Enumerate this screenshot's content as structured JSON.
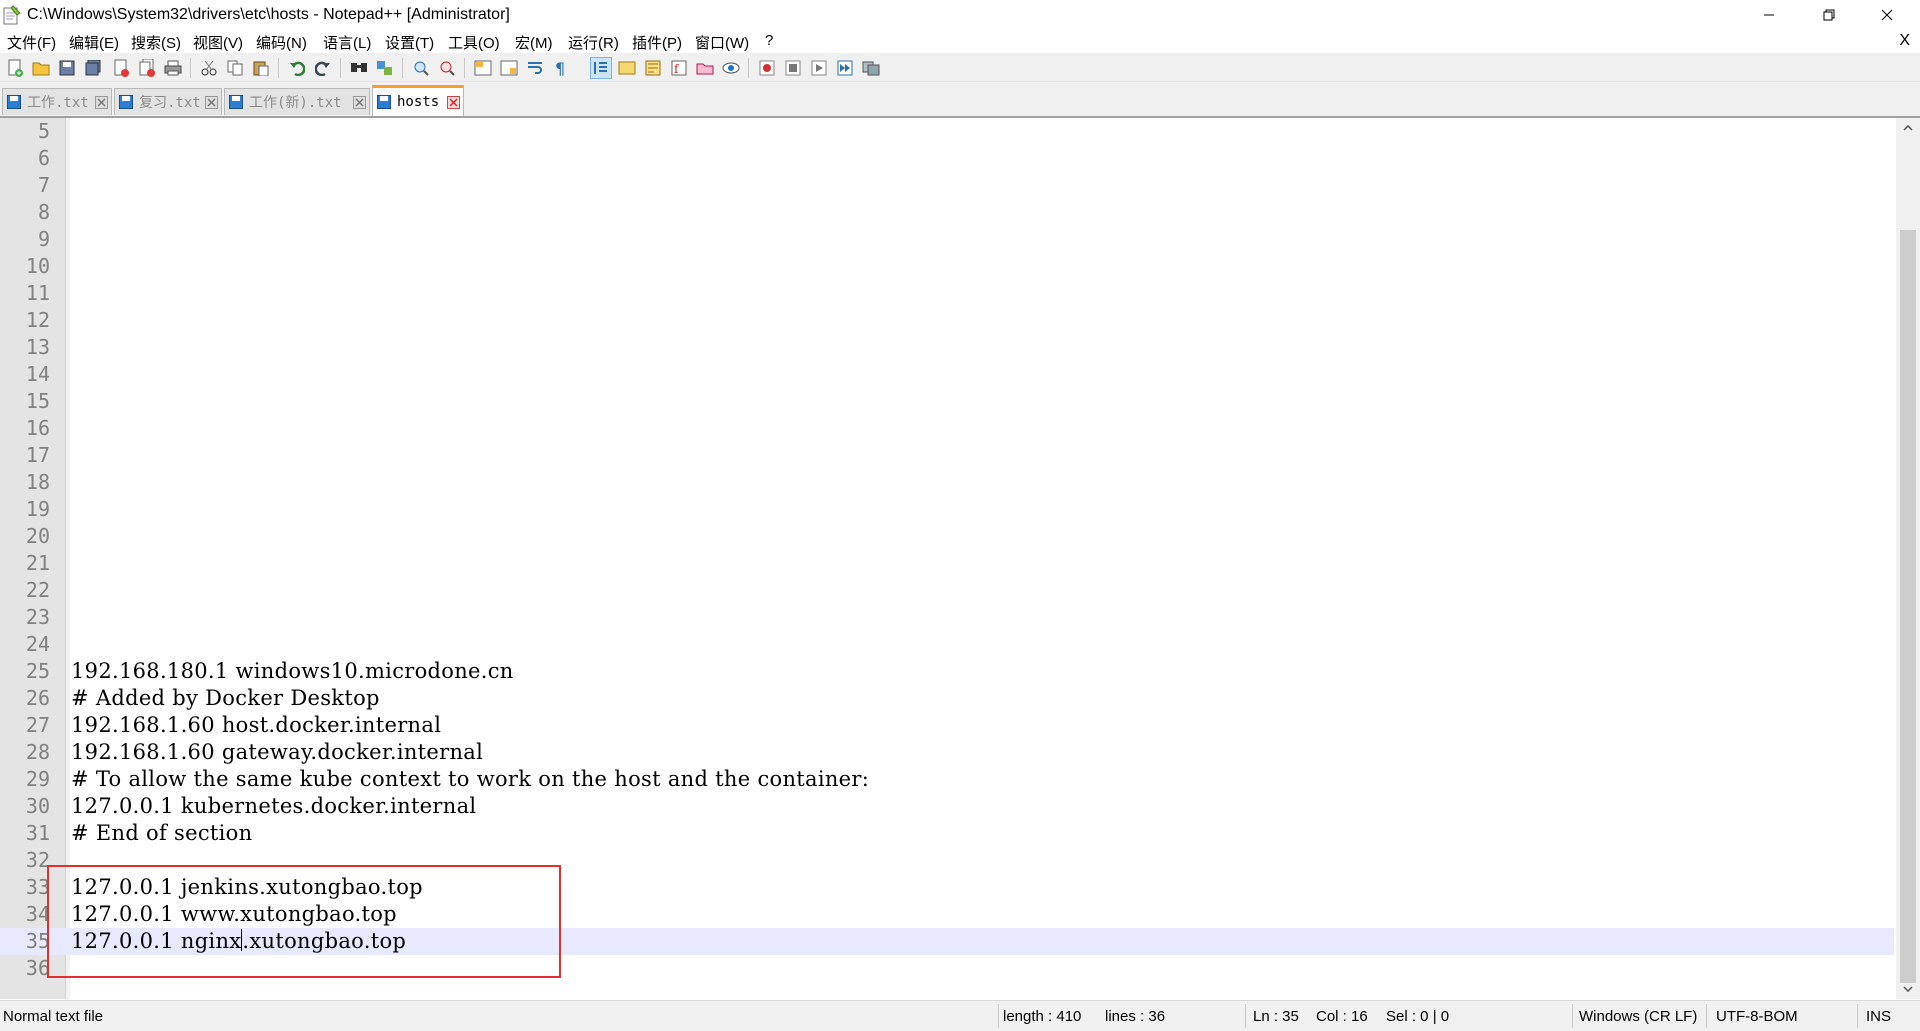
{
  "window": {
    "title": "C:\\Windows\\System32\\drivers\\etc\\hosts - Notepad++ [Administrator]",
    "minimize_glyph": "—",
    "close_glyph": "✕"
  },
  "menu": {
    "items": [
      {
        "label": "文件(F)"
      },
      {
        "label": "编辑(E)"
      },
      {
        "label": "搜索(S)"
      },
      {
        "label": "视图(V)"
      },
      {
        "label": "编码(N)"
      },
      {
        "label": "语言(L)"
      },
      {
        "label": "设置(T)"
      },
      {
        "label": "工具(O)"
      },
      {
        "label": "宏(M)"
      },
      {
        "label": "运行(R)"
      },
      {
        "label": "插件(P)"
      },
      {
        "label": "窗口(W)"
      },
      {
        "label": "?"
      }
    ],
    "close_doc": "X"
  },
  "tabs": [
    {
      "label": "工作.txt",
      "active": false
    },
    {
      "label": "复习.txt",
      "active": false
    },
    {
      "label": "工作(新).txt",
      "active": false
    },
    {
      "label": "hosts",
      "active": true
    }
  ],
  "editor": {
    "lines": [
      {
        "num": "5",
        "text": ""
      },
      {
        "num": "6",
        "text": ""
      },
      {
        "num": "7",
        "text": ""
      },
      {
        "num": "8",
        "text": ""
      },
      {
        "num": "9",
        "text": ""
      },
      {
        "num": "10",
        "text": ""
      },
      {
        "num": "11",
        "text": ""
      },
      {
        "num": "12",
        "text": ""
      },
      {
        "num": "13",
        "text": ""
      },
      {
        "num": "14",
        "text": ""
      },
      {
        "num": "15",
        "text": ""
      },
      {
        "num": "16",
        "text": ""
      },
      {
        "num": "17",
        "text": ""
      },
      {
        "num": "18",
        "text": ""
      },
      {
        "num": "19",
        "text": ""
      },
      {
        "num": "20",
        "text": ""
      },
      {
        "num": "21",
        "text": ""
      },
      {
        "num": "22",
        "text": ""
      },
      {
        "num": "23",
        "text": ""
      },
      {
        "num": "24",
        "text": ""
      },
      {
        "num": "25",
        "text": "192.168.180.1 windows10.microdone.cn"
      },
      {
        "num": "26",
        "text": "# Added by Docker Desktop"
      },
      {
        "num": "27",
        "text": "192.168.1.60 host.docker.internal"
      },
      {
        "num": "28",
        "text": "192.168.1.60 gateway.docker.internal"
      },
      {
        "num": "29",
        "text": "# To allow the same kube context to work on the host and the container:"
      },
      {
        "num": "30",
        "text": "127.0.0.1 kubernetes.docker.internal"
      },
      {
        "num": "31",
        "text": "# End of section"
      },
      {
        "num": "32",
        "text": ""
      },
      {
        "num": "33",
        "text": "127.0.0.1 jenkins.xutongbao.top"
      },
      {
        "num": "34",
        "text": "127.0.0.1 www.xutongbao.top"
      },
      {
        "num": "35",
        "text_before_caret": "127.0.0.1 nginx",
        "text_after_caret": ".xutongbao.top",
        "current": true
      },
      {
        "num": "36",
        "text": ""
      }
    ]
  },
  "statusbar": {
    "language": "Normal text file",
    "length": "length : 410",
    "lines": "lines : 36",
    "ln": "Ln : 35",
    "col": "Col : 16",
    "sel": "Sel : 0 | 0",
    "eol": "Windows (CR LF)",
    "encoding": "UTF-8-BOM",
    "mode": "INS"
  },
  "colors": {
    "current_line": "#e8e8ff",
    "annotation_box": "#e03030",
    "active_tab_accent": "#fa9c2b"
  }
}
